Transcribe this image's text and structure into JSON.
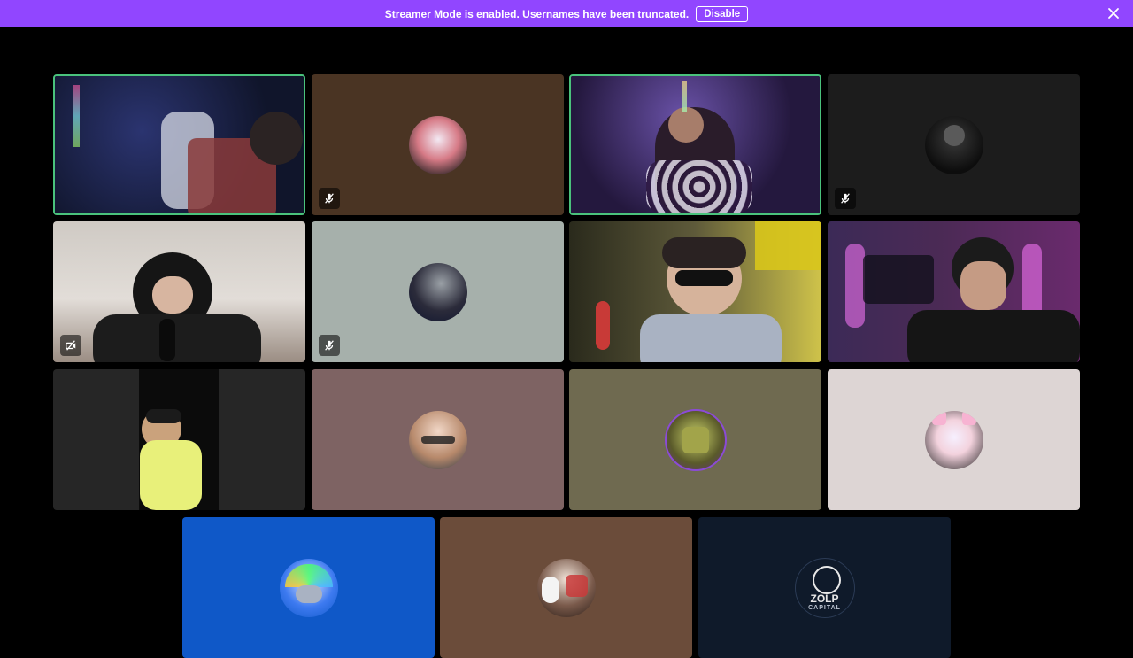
{
  "banner": {
    "message": "Streamer Mode is enabled. Usernames have been truncated.",
    "disable_label": "Disable",
    "color": "#9146ff"
  },
  "accent": {
    "speaking": "#4ac27c"
  },
  "tiles": [
    {
      "kind": "video",
      "bg": "#1a1f3a",
      "speaking": true,
      "muted": false
    },
    {
      "kind": "avatar",
      "bg": "#4a3423",
      "speaking": false,
      "muted": true
    },
    {
      "kind": "video",
      "bg": "#211a3a",
      "speaking": true,
      "muted": false
    },
    {
      "kind": "avatar",
      "bg": "#1c1c1c",
      "speaking": false,
      "muted": true
    },
    {
      "kind": "video",
      "bg": "#d7d2cc",
      "speaking": false,
      "muted": false,
      "video_off": true
    },
    {
      "kind": "avatar",
      "bg": "#a6b0ab",
      "speaking": false,
      "muted": true
    },
    {
      "kind": "video",
      "bg": "#5f5a3a",
      "speaking": false,
      "muted": false
    },
    {
      "kind": "video",
      "bg": "#3b2a4c",
      "speaking": false,
      "muted": false
    },
    {
      "kind": "video",
      "bg": "#262626",
      "speaking": false,
      "muted": false
    },
    {
      "kind": "avatar",
      "bg": "#7e6363",
      "speaking": false,
      "muted": false
    },
    {
      "kind": "avatar",
      "bg": "#6f6a50",
      "speaking": false,
      "muted": false
    },
    {
      "kind": "avatar",
      "bg": "#ddd5d4",
      "speaking": false,
      "muted": false
    },
    {
      "kind": "avatar",
      "bg": "#0f58c8",
      "speaking": false,
      "muted": false
    },
    {
      "kind": "avatar",
      "bg": "#6b4c3a",
      "speaking": false,
      "muted": false
    },
    {
      "kind": "avatar",
      "bg": "#0f1a2a",
      "speaking": false,
      "muted": false,
      "avatar_text": "ZOLP",
      "avatar_sub": "CAPITAL"
    }
  ]
}
